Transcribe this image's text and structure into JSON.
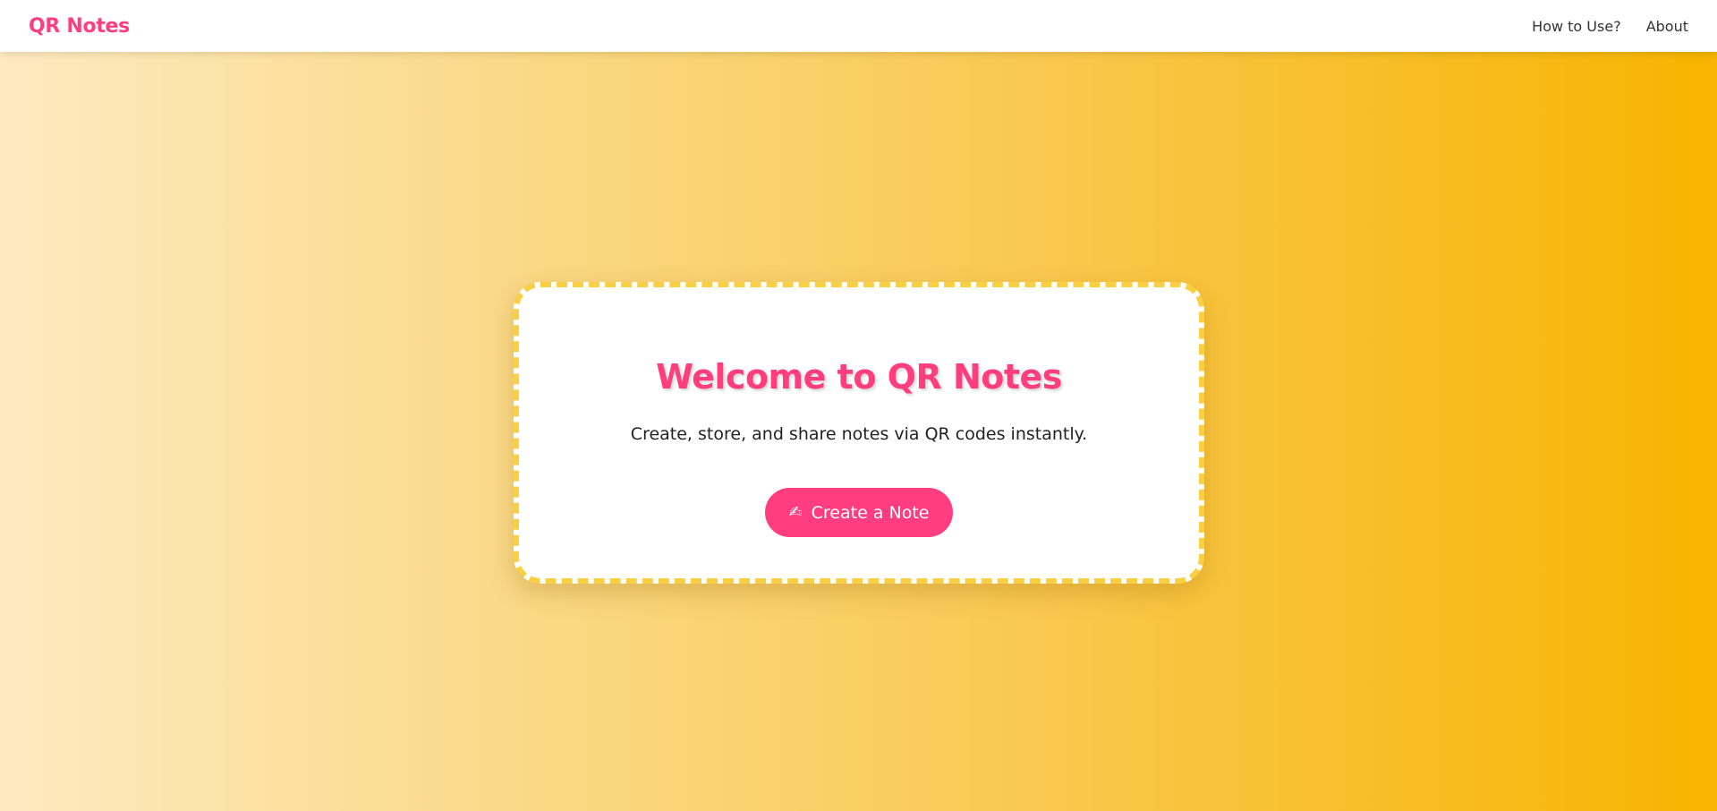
{
  "navbar": {
    "brand": "QR Notes",
    "links": [
      {
        "label": "How to Use?"
      },
      {
        "label": "About"
      }
    ]
  },
  "hero": {
    "title": "Welcome to QR Notes",
    "subtitle": "Create, store, and share notes via QR codes instantly.",
    "cta": {
      "icon": "✍",
      "icon_name": "writing-hand-icon",
      "label": "Create a Note"
    }
  },
  "colors": {
    "accent": "#ff3d7f",
    "border": "#f9cf43",
    "gradient_start": "#fdeac0",
    "gradient_end": "#f7b400"
  }
}
